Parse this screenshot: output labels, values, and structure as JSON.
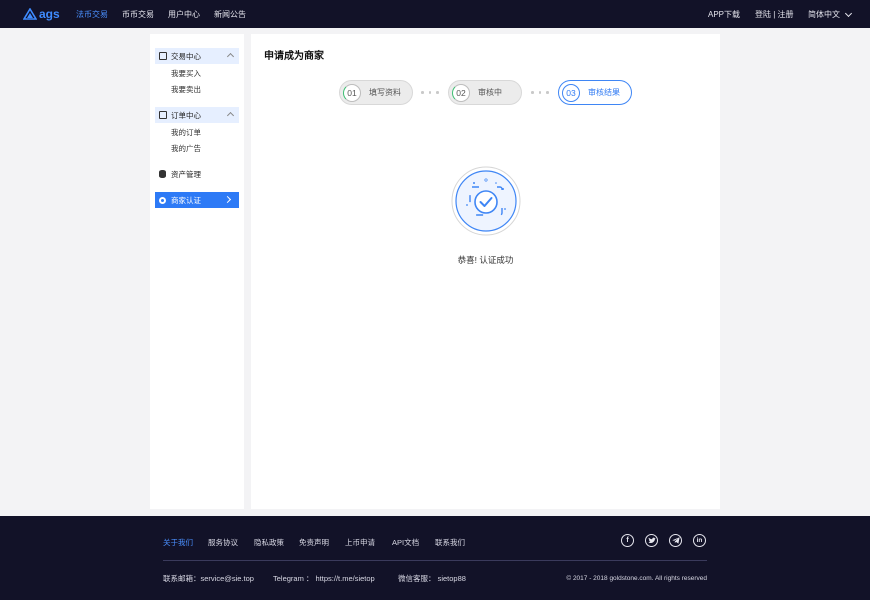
{
  "nav": {
    "logo_text": "ags",
    "items": [
      "法币交易",
      "币币交易",
      "用户中心",
      "新闻公告"
    ],
    "active_index": 0,
    "app_download": "APP下载",
    "login_register": "登陆 | 注册",
    "language": "简体中文"
  },
  "sidebar": {
    "trade_center": "交易中心",
    "buy": "我要买入",
    "sell": "我要卖出",
    "order_center": "订单中心",
    "my_orders": "我的订单",
    "my_ads": "我的广告",
    "asset_mgmt": "资产管理",
    "merchant_cert": "商家认证"
  },
  "main": {
    "title": "申请成为商家",
    "steps": [
      {
        "num": "01",
        "label": "填写资料",
        "state": "done"
      },
      {
        "num": "02",
        "label": "审核中",
        "state": "done"
      },
      {
        "num": "03",
        "label": "审核结果",
        "state": "current"
      }
    ],
    "success_text": "恭喜! 认证成功"
  },
  "footer": {
    "links": [
      "关于我们",
      "服务协议",
      "隐私政策",
      "免责声明",
      "上币申请",
      "API文档",
      "联系我们"
    ],
    "email": "联系邮箱：service@sie.top",
    "telegram": "Telegram ： https://t.me/sietop",
    "wechat": "微信客服： sietop88",
    "copyright": "© 2017 - 2018 goldstone.com. All rights reserved",
    "social": [
      "facebook-icon",
      "twitter-icon",
      "telegram-icon",
      "linkedin-icon"
    ]
  },
  "colors": {
    "nav_bg": "#121228",
    "accent": "#2d7af6",
    "page_bg": "#f3f3f5"
  }
}
